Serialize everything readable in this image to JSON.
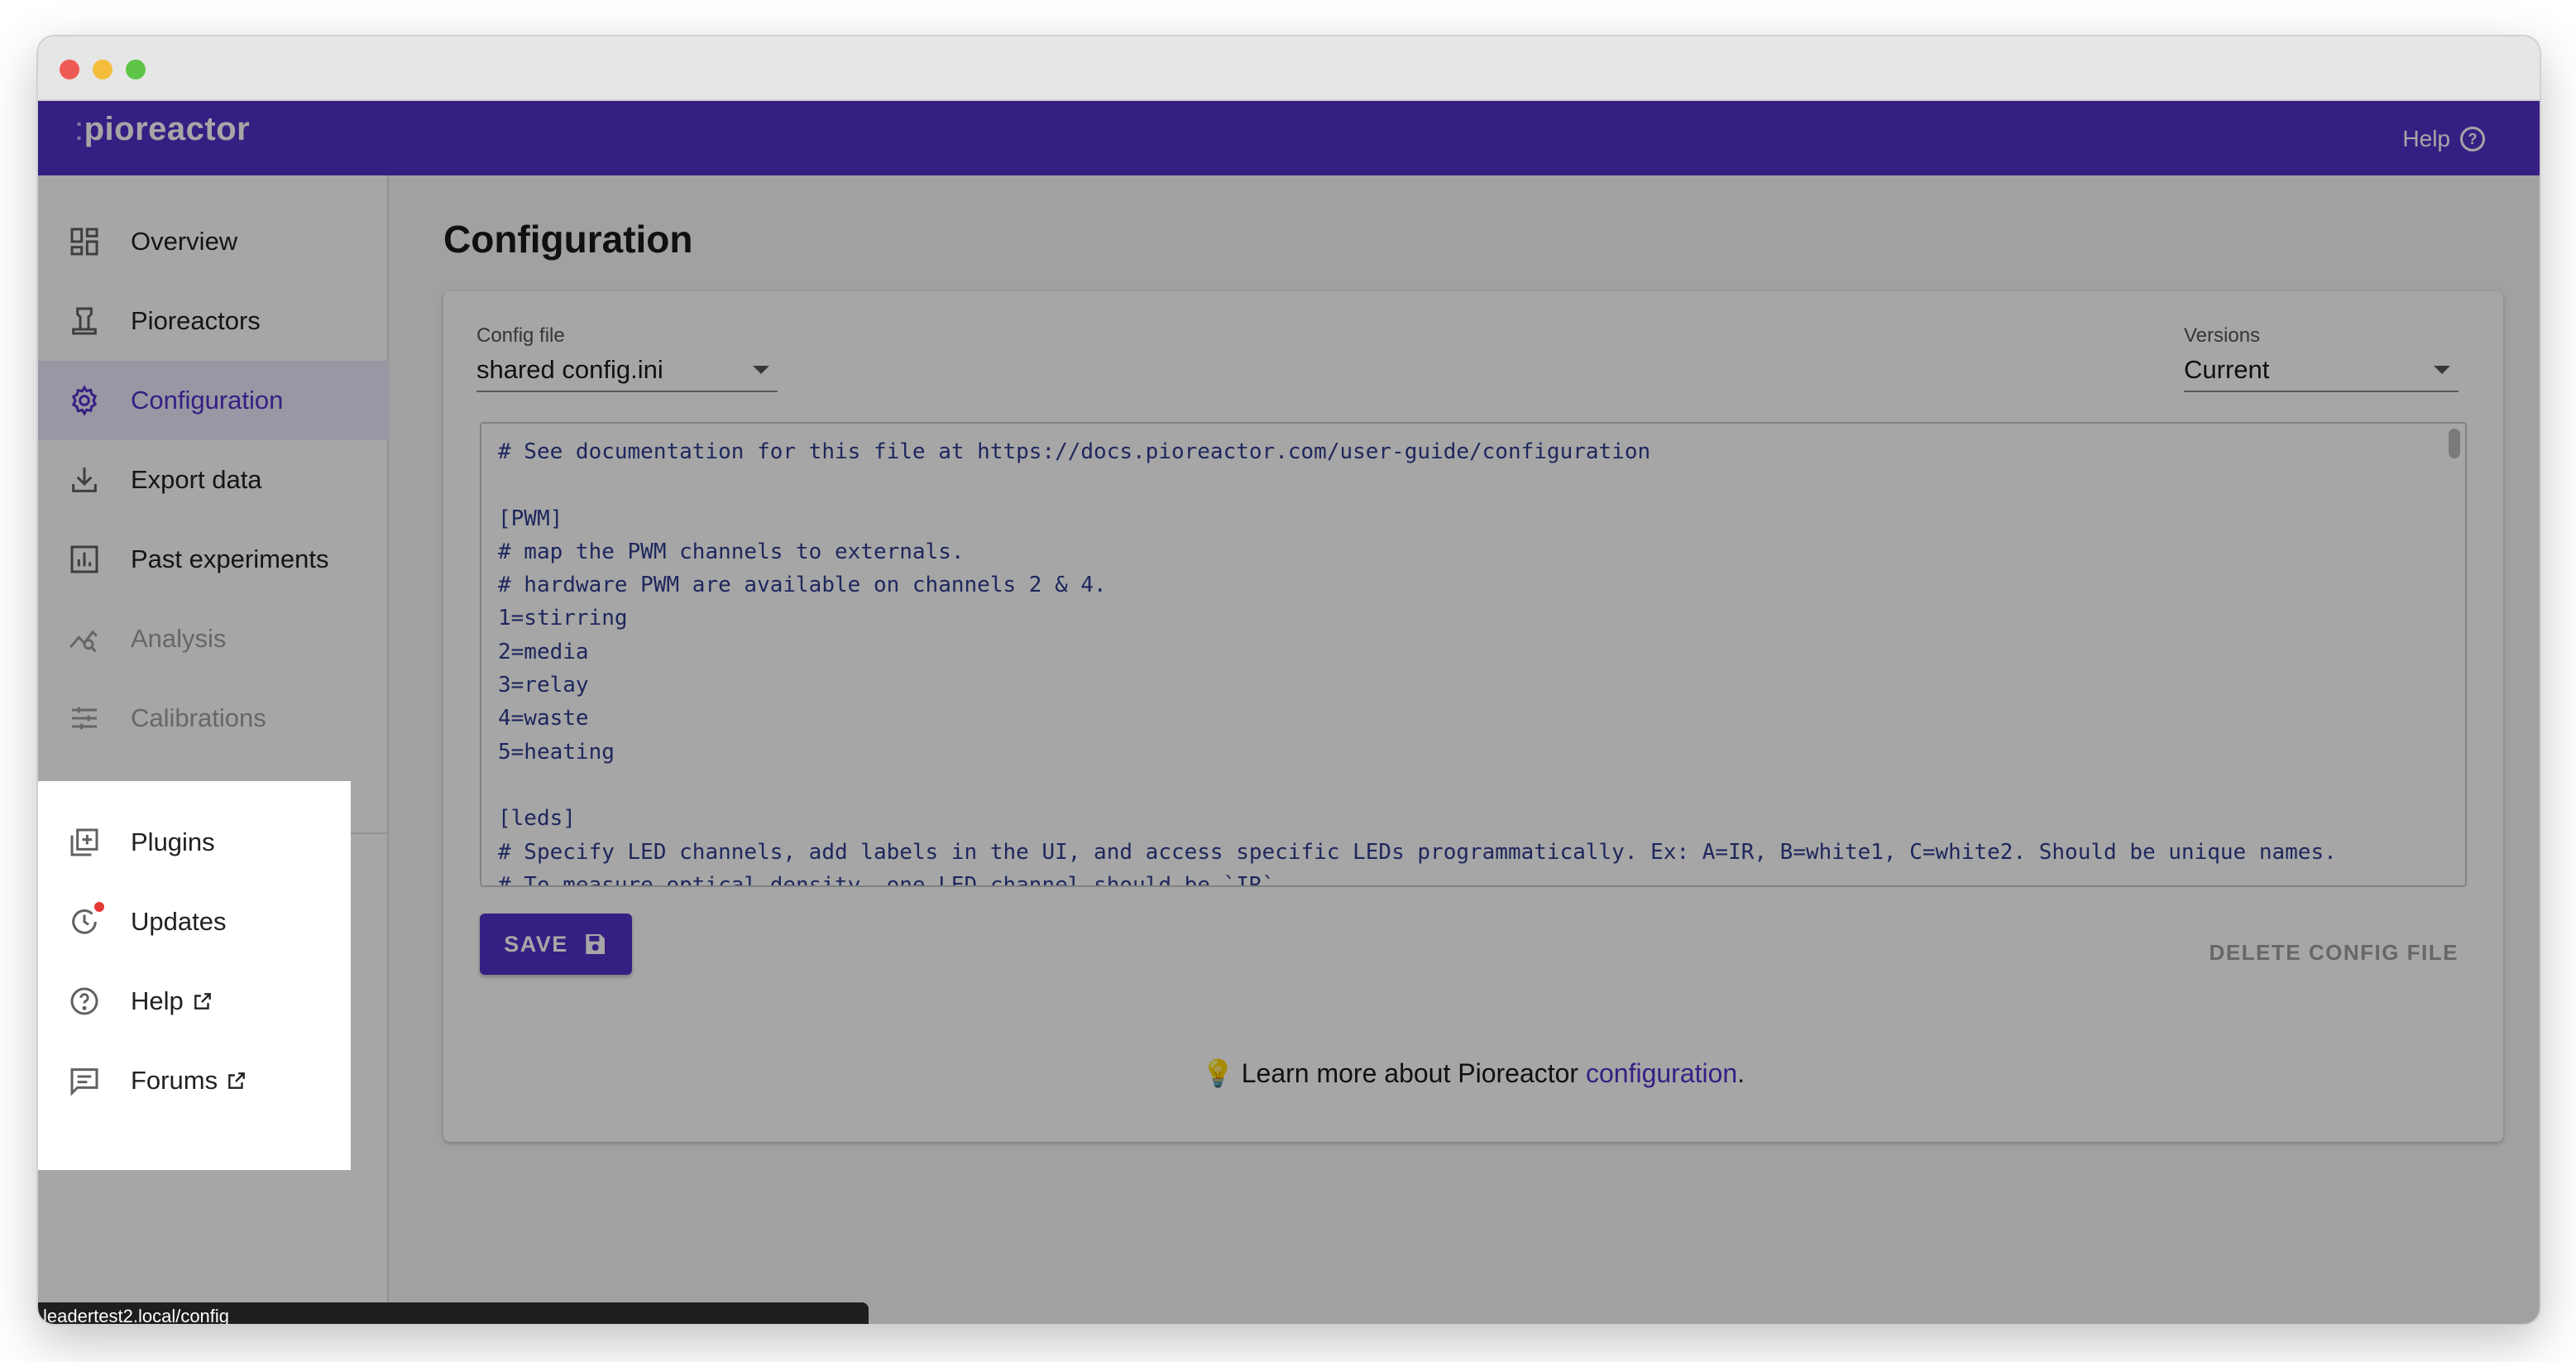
{
  "app": {
    "logo_dots": ":",
    "logo_text": "pioreactor",
    "help_label": "Help"
  },
  "sidebar": {
    "items": [
      {
        "label": "Overview",
        "icon": "dashboard-icon",
        "state": "normal"
      },
      {
        "label": "Pioreactors",
        "icon": "pioreactor-icon",
        "state": "normal"
      },
      {
        "label": "Configuration",
        "icon": "gear-icon",
        "state": "selected"
      },
      {
        "label": "Export data",
        "icon": "download-icon",
        "state": "normal"
      },
      {
        "label": "Past experiments",
        "icon": "bar-chart-icon",
        "state": "normal"
      },
      {
        "label": "Analysis",
        "icon": "analysis-icon",
        "state": "disabled"
      },
      {
        "label": "Calibrations",
        "icon": "sliders-icon",
        "state": "disabled"
      }
    ],
    "secondary": [
      {
        "label": "Plugins",
        "icon": "add-box-icon"
      },
      {
        "label": "Updates",
        "icon": "update-icon"
      },
      {
        "label": "Help",
        "icon": "help-circle-icon"
      },
      {
        "label": "Forums",
        "icon": "forum-icon"
      }
    ]
  },
  "main": {
    "title": "Configuration",
    "config_file_label": "Config file",
    "config_file_value": "shared config.ini",
    "versions_label": "Versions",
    "versions_value": "Current",
    "editor_text": "# See documentation for this file at https://docs.pioreactor.com/user-guide/configuration\n\n[PWM]\n# map the PWM channels to externals.\n# hardware PWM are available on channels 2 & 4.\n1=stirring\n2=media\n3=relay\n4=waste\n5=heating\n\n[leds]\n# Specify LED channels, add labels in the UI, and access specific LEDs programmatically. Ex: A=IR, B=white1, C=white2. Should be unique names.\n# To measure optical density, one LED channel should be `IR`",
    "save_label": "SAVE",
    "delete_label": "DELETE CONFIG FILE",
    "learn_prefix": "Learn more about Pioreactor ",
    "learn_link": "configuration",
    "learn_suffix": "."
  },
  "status_bar": {
    "url": "leadertest2.local/config"
  },
  "colors": {
    "brand": "#5331ca",
    "notification": "#e53935"
  }
}
